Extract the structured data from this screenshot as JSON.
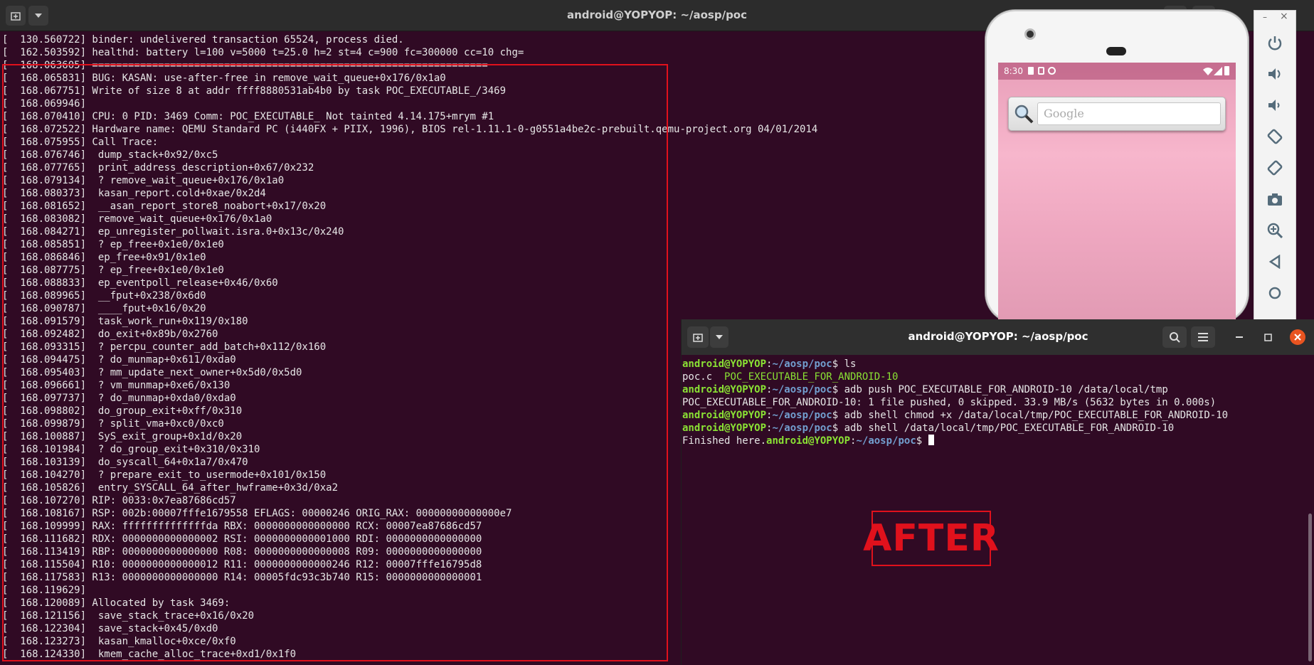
{
  "main_window": {
    "title": "android@YOPYOP: ~/aosp/poc",
    "new_tab_icon": "new-tab-icon",
    "menu_icon": "chevron-down-icon"
  },
  "dmesg_lines": [
    "[  130.560722] binder: undelivered transaction 65524, process died.",
    "[  162.503592] healthd: battery l=100 v=5000 t=25.0 h=2 st=4 c=900 fc=300000 cc=10 chg=",
    "[  168.063605] ==================================================================",
    "[  168.065831] BUG: KASAN: use-after-free in remove_wait_queue+0x176/0x1a0",
    "[  168.067751] Write of size 8 at addr ffff8880531ab4b0 by task POC_EXECUTABLE_/3469",
    "[  168.069946]",
    "[  168.070410] CPU: 0 PID: 3469 Comm: POC_EXECUTABLE_ Not tainted 4.14.175+mrym #1",
    "[  168.072522] Hardware name: QEMU Standard PC (i440FX + PIIX, 1996), BIOS rel-1.11.1-0-g0551a4be2c-prebuilt.qemu-project.org 04/01/2014",
    "[  168.075955] Call Trace:",
    "[  168.076746]  dump_stack+0x92/0xc5",
    "[  168.077765]  print_address_description+0x67/0x232",
    "[  168.079134]  ? remove_wait_queue+0x176/0x1a0",
    "[  168.080373]  kasan_report.cold+0xae/0x2d4",
    "[  168.081652]  __asan_report_store8_noabort+0x17/0x20",
    "[  168.083082]  remove_wait_queue+0x176/0x1a0",
    "[  168.084271]  ep_unregister_pollwait.isra.0+0x13c/0x240",
    "[  168.085851]  ? ep_free+0x1e0/0x1e0",
    "[  168.086846]  ep_free+0x91/0x1e0",
    "[  168.087775]  ? ep_free+0x1e0/0x1e0",
    "[  168.088833]  ep_eventpoll_release+0x46/0x60",
    "[  168.089965]  __fput+0x238/0x6d0",
    "[  168.090787]  ____fput+0x16/0x20",
    "[  168.091579]  task_work_run+0x119/0x180",
    "[  168.092482]  do_exit+0x89b/0x2760",
    "[  168.093315]  ? percpu_counter_add_batch+0x112/0x160",
    "[  168.094475]  ? do_munmap+0x611/0xda0",
    "[  168.095403]  ? mm_update_next_owner+0x5d0/0x5d0",
    "[  168.096661]  ? vm_munmap+0xe6/0x130",
    "[  168.097737]  ? do_munmap+0xda0/0xda0",
    "[  168.098802]  do_group_exit+0xff/0x310",
    "[  168.099879]  ? split_vma+0xc0/0xc0",
    "[  168.100887]  SyS_exit_group+0x1d/0x20",
    "[  168.101984]  ? do_group_exit+0x310/0x310",
    "[  168.103139]  do_syscall_64+0x1a7/0x470",
    "[  168.104270]  ? prepare_exit_to_usermode+0x101/0x150",
    "[  168.105826]  entry_SYSCALL_64_after_hwframe+0x3d/0xa2",
    "[  168.107270] RIP: 0033:0x7ea87686cd57",
    "[  168.108167] RSP: 002b:00007fffe1679558 EFLAGS: 00000246 ORIG_RAX: 00000000000000e7",
    "[  168.109999] RAX: ffffffffffffffda RBX: 0000000000000000 RCX: 00007ea87686cd57",
    "[  168.111682] RDX: 0000000000000002 RSI: 0000000000001000 RDI: 0000000000000000",
    "[  168.113419] RBP: 0000000000000000 R08: 0000000000000008 R09: 0000000000000000",
    "[  168.115504] R10: 0000000000000012 R11: 0000000000000246 R12: 00007fffe16795d8",
    "[  168.117583] R13: 0000000000000000 R14: 00005fdc93c3b740 R15: 0000000000000001",
    "[  168.119629]",
    "[  168.120089] Allocated by task 3469:",
    "[  168.121156]  save_stack_trace+0x16/0x20",
    "[  168.122304]  save_stack+0x45/0xd0",
    "[  168.123273]  kasan_kmalloc+0xce/0xf0",
    "[  168.124330]  kmem_cache_alloc_trace+0xd1/0x1f0"
  ],
  "emulator": {
    "status_time": "8:30",
    "search_placeholder": "Google",
    "window_close": "×",
    "window_min": "–",
    "controls": [
      "power-icon",
      "volume-up-icon",
      "volume-down-icon",
      "rotate-left-icon",
      "rotate-right-icon",
      "camera-icon",
      "zoom-icon",
      "back-icon",
      "home-icon"
    ]
  },
  "second_terminal": {
    "title": "android@YOPYOP: ~/aosp/poc",
    "prompt_user": "android@YOPYOP",
    "prompt_sep": ":",
    "prompt_path": "~/aosp/poc",
    "prompt_dollar": "$",
    "commands": [
      " ls",
      " adb push POC_EXECUTABLE_FOR_ANDROID-10 /data/local/tmp",
      " adb shell chmod +x /data/local/tmp/POC_EXECUTABLE_FOR_ANDROID-10",
      " adb shell /data/local/tmp/POC_EXECUTABLE_FOR_ANDROID-10",
      " "
    ],
    "ls_file": "poc.c",
    "ls_exec": "POC_EXECUTABLE_FOR_ANDROID-10",
    "push_output": "POC_EXECUTABLE_FOR_ANDROID-10: 1 file pushed, 0 skipped. 33.9 MB/s (5632 bytes in 0.000s)",
    "finished_text": "Finished here."
  },
  "annotation": {
    "after_label": "AFTER"
  }
}
